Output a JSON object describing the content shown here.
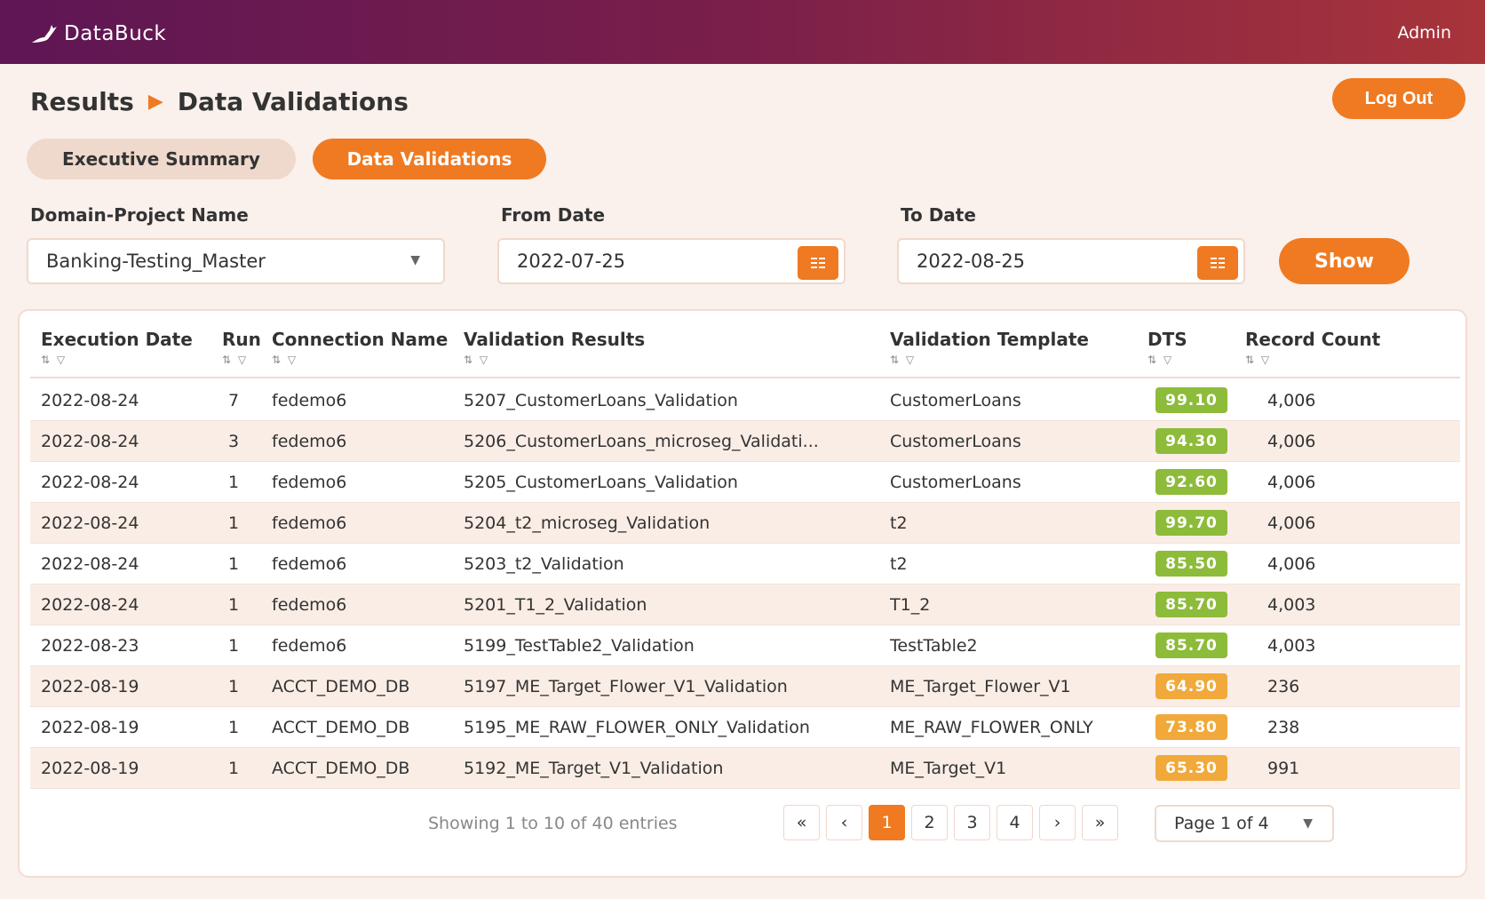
{
  "app": {
    "brand": "DataBuck",
    "user": "Admin",
    "logout_label": "Log Out"
  },
  "breadcrumb": {
    "parent": "Results",
    "separator": "▶",
    "current": "Data Validations"
  },
  "tabs": {
    "executive_summary": "Executive Summary",
    "data_validations": "Data Validations"
  },
  "filters": {
    "domain_label": "Domain-Project Name",
    "domain_value": "Banking-Testing_Master",
    "from_label": "From Date",
    "from_value": "2022-07-25",
    "to_label": "To Date",
    "to_value": "2022-08-25",
    "show_label": "Show"
  },
  "table": {
    "sort_glyph": "⇅ ▽",
    "columns": {
      "execution_date": "Execution Date",
      "run": "Run",
      "connection_name": "Connection Name",
      "validation_results": "Validation Results",
      "validation_template": "Validation Template",
      "dts": "DTS",
      "record_count": "Record Count"
    },
    "rows": [
      {
        "date": "2022-08-24",
        "run": "7",
        "conn": "fedemo6",
        "result": "5207_CustomerLoans_Validation",
        "template": "CustomerLoans",
        "dts": "99.10",
        "dts_level": "good",
        "count": "4,006"
      },
      {
        "date": "2022-08-24",
        "run": "3",
        "conn": "fedemo6",
        "result": "5206_CustomerLoans_microseg_Validati...",
        "template": "CustomerLoans",
        "dts": "94.30",
        "dts_level": "good",
        "count": "4,006"
      },
      {
        "date": "2022-08-24",
        "run": "1",
        "conn": "fedemo6",
        "result": "5205_CustomerLoans_Validation",
        "template": "CustomerLoans",
        "dts": "92.60",
        "dts_level": "good",
        "count": "4,006"
      },
      {
        "date": "2022-08-24",
        "run": "1",
        "conn": "fedemo6",
        "result": "5204_t2_microseg_Validation",
        "template": "t2",
        "dts": "99.70",
        "dts_level": "good",
        "count": "4,006"
      },
      {
        "date": "2022-08-24",
        "run": "1",
        "conn": "fedemo6",
        "result": "5203_t2_Validation",
        "template": "t2",
        "dts": "85.50",
        "dts_level": "good",
        "count": "4,006"
      },
      {
        "date": "2022-08-24",
        "run": "1",
        "conn": "fedemo6",
        "result": "5201_T1_2_Validation",
        "template": "T1_2",
        "dts": "85.70",
        "dts_level": "good",
        "count": "4,003"
      },
      {
        "date": "2022-08-23",
        "run": "1",
        "conn": "fedemo6",
        "result": "5199_TestTable2_Validation",
        "template": "TestTable2",
        "dts": "85.70",
        "dts_level": "good",
        "count": "4,003"
      },
      {
        "date": "2022-08-19",
        "run": "1",
        "conn": "ACCT_DEMO_DB",
        "result": "5197_ME_Target_Flower_V1_Validation",
        "template": "ME_Target_Flower_V1",
        "dts": "64.90",
        "dts_level": "warn",
        "count": "236"
      },
      {
        "date": "2022-08-19",
        "run": "1",
        "conn": "ACCT_DEMO_DB",
        "result": "5195_ME_RAW_FLOWER_ONLY_Validation",
        "template": "ME_RAW_FLOWER_ONLY",
        "dts": "73.80",
        "dts_level": "warn",
        "count": "238"
      },
      {
        "date": "2022-08-19",
        "run": "1",
        "conn": "ACCT_DEMO_DB",
        "result": "5192_ME_Target_V1_Validation",
        "template": "ME_Target_V1",
        "dts": "65.30",
        "dts_level": "warn",
        "count": "991"
      }
    ]
  },
  "pagination": {
    "showing": "Showing 1 to 10 of 40 entries",
    "first": "«",
    "prev": "‹",
    "next": "›",
    "last": "»",
    "pages": [
      "1",
      "2",
      "3",
      "4"
    ],
    "current_page": "1",
    "page_select": "Page 1 of 4"
  },
  "colors": {
    "accent": "#ef7a22",
    "dts_good": "#8dbb3a",
    "dts_warn": "#f0a93a",
    "row_alt": "#faede6"
  },
  "icons": {
    "logo": "deer-logo-icon",
    "calendar": "calendar-icon",
    "dropdown": "chevron-down-icon"
  }
}
